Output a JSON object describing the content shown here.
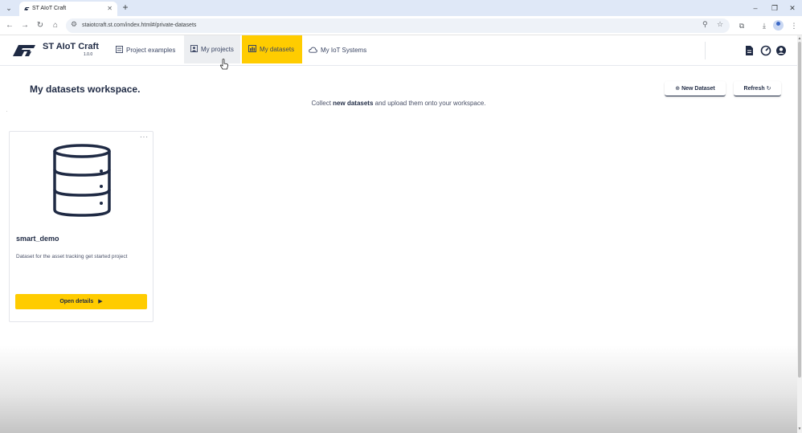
{
  "browser": {
    "tab_title": "ST AIoT Craft",
    "url": "staiotcraft.st.com/index.html#/private-datasets",
    "window_controls": [
      "–",
      "❐",
      "✕"
    ]
  },
  "app": {
    "brand": "ST AIoT Craft",
    "version": "1.0.0",
    "nav": {
      "project_examples": "Project examples",
      "my_projects": "My projects",
      "my_datasets": "My datasets",
      "my_iot_systems": "My IoT Systems"
    },
    "accent_color": "#ffcc00",
    "active_tab": "My datasets"
  },
  "main": {
    "title": "My datasets workspace.",
    "subtitle_pre": "Collect ",
    "subtitle_bold": "new datasets",
    "subtitle_post": " and upload them onto your workspace.",
    "new_dataset_label": "New Dataset",
    "refresh_label": "Refresh"
  },
  "datasets": [
    {
      "name": "smart_demo",
      "description": "Dataset for the asset tracking get started project",
      "button_label": "Open details",
      "icon": "database-icon"
    }
  ]
}
